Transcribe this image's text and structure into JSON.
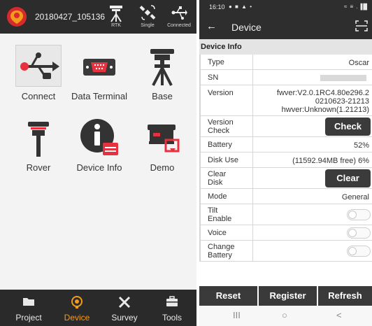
{
  "left_app": {
    "title": "20180427_105136",
    "status_icons": [
      {
        "icon": "rtk-antenna-icon",
        "label": "RTK"
      },
      {
        "icon": "satellite-icon",
        "label": "Single"
      },
      {
        "icon": "usb-connected-icon",
        "label": "Connected"
      }
    ],
    "tiles": [
      {
        "icon": "usb-icon",
        "label": "Connect",
        "selected": true
      },
      {
        "icon": "serial-port-icon",
        "label": "Data Terminal"
      },
      {
        "icon": "base-station-icon",
        "label": "Base"
      },
      {
        "icon": "rover-icon",
        "label": "Rover"
      },
      {
        "icon": "info-icon",
        "label": "Device Info"
      },
      {
        "icon": "demo-icon",
        "label": "Demo"
      }
    ],
    "bottom_nav": [
      {
        "icon": "folder-icon",
        "label": "Project"
      },
      {
        "icon": "device-icon",
        "label": "Device",
        "active": true
      },
      {
        "icon": "survey-icon",
        "label": "Survey"
      },
      {
        "icon": "toolbox-icon",
        "label": "Tools"
      }
    ],
    "colors": {
      "accent": "#f29b1d",
      "bar": "#2a2a2a",
      "icon_red": "#e8313f"
    }
  },
  "right_app": {
    "status_bar": {
      "time": "16:10",
      "left_icons": "● ■ ▲ •",
      "right_icons": "≈ ≡ .▐█"
    },
    "title": "Device",
    "back_icon": "←",
    "section": "Device Info",
    "rows": {
      "type": {
        "label": "Type",
        "value": "Oscar"
      },
      "sn": {
        "label": "SN"
      },
      "version": {
        "label": "Version",
        "line1": "fwver:V2.0.1RC4.80e296.2",
        "line2": "0210623-21213",
        "line3": "hwver:Unknown(1.21213)"
      },
      "version_check": {
        "label1": "Version",
        "label2": "Check",
        "button": "Check"
      },
      "battery": {
        "label": "Battery",
        "value": "52%"
      },
      "disk_use": {
        "label": "Disk Use",
        "value": "(11592.94MB free) 6%"
      },
      "clear_disk": {
        "label1": "Clear",
        "label2": "Disk",
        "button": "Clear"
      },
      "mode": {
        "label": "Mode",
        "value": "General"
      },
      "tilt_enable": {
        "label1": "Tilt",
        "label2": "Enable",
        "on": false
      },
      "voice": {
        "label": "Voice",
        "on": false
      },
      "change_battery": {
        "label1": "Change",
        "label2": "Battery",
        "on": false
      }
    },
    "bottom_buttons": {
      "reset": "Reset",
      "register": "Register",
      "refresh": "Refresh"
    },
    "system_nav": {
      "recents": "III",
      "home": "○",
      "back": "<"
    }
  }
}
